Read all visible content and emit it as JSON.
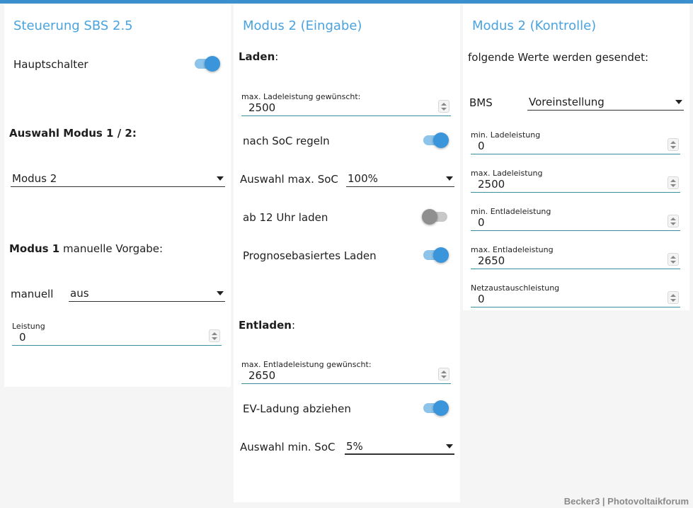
{
  "col1": {
    "title": "Steuerung SBS 2.5",
    "hauptschalter_label": "Hauptschalter",
    "auswahl_heading": "Auswahl Modus 1 / 2:",
    "modus_select_value": "Modus 2",
    "modus1_heading_bold": "Modus 1",
    "modus1_heading_rest": " manuelle Vorgabe:",
    "manuell_label": "manuell",
    "manuell_select_value": "aus",
    "leistung_label": "Leistung",
    "leistung_value": "0"
  },
  "col2": {
    "title": "Modus 2 (Eingabe)",
    "laden_heading": "Laden",
    "laden_colon": ":",
    "max_ladeleistung_label": "max. Ladeleistung gewünscht:",
    "max_ladeleistung_value": "2500",
    "nach_soc_label": "nach SoC regeln",
    "max_soc_label": "Auswahl max. SoC",
    "max_soc_value": "100%",
    "ab12_label": "ab 12 Uhr laden",
    "prognose_label": "Prognosebasiertes Laden",
    "entladen_heading": "Entladen",
    "entladen_colon": ":",
    "max_entladeleistung_label": "max. Entladeleistung gewünscht:",
    "max_entladeleistung_value": "2650",
    "ev_label": "EV-Ladung abziehen",
    "min_soc_label": "Auswahl min. SoC",
    "min_soc_value": "5%"
  },
  "col3": {
    "title": "Modus 2 (Kontrolle)",
    "subtitle": "folgende Werte werden gesendet:",
    "bms_label": "BMS",
    "bms_value": "Voreinstellung",
    "fields": [
      {
        "label": "min. Ladeleistung",
        "value": "0"
      },
      {
        "label": "max. Ladeleistung",
        "value": "2500"
      },
      {
        "label": "min. Entladeleistung",
        "value": "0"
      },
      {
        "label": "max. Entladeleistung",
        "value": "2650"
      },
      {
        "label": "Netzaustauschleistung",
        "value": "0"
      }
    ]
  },
  "switches": {
    "hauptschalter": true,
    "nach_soc": true,
    "ab12": false,
    "prognose": true,
    "ev": true
  },
  "colors": {
    "accent": "#3a8fcc",
    "title": "#4aa3df",
    "switch_on": "#3a95db",
    "switch_off": "#8f8f8f"
  },
  "icons": {
    "dropdown": "chevron-down-icon",
    "spinner": "spinner-icon"
  },
  "watermark": "Becker3 | Photovoltaikforum"
}
